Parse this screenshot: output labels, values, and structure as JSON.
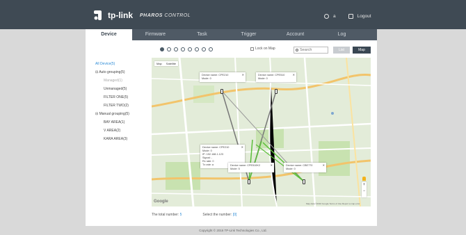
{
  "header": {
    "brand": "tp-link",
    "product_prefix": "PHAROS",
    "product_suffix": "CONTROL",
    "user_initial": "a",
    "logout_label": "Logout"
  },
  "nav": {
    "tabs": [
      {
        "label": "Device",
        "active": true
      },
      {
        "label": "Firmware",
        "active": false
      },
      {
        "label": "Task",
        "active": false
      },
      {
        "label": "Trigger",
        "active": false
      },
      {
        "label": "Account",
        "active": false
      },
      {
        "label": "Log",
        "active": false
      }
    ]
  },
  "sidebar": {
    "items": [
      {
        "label": "All Device(5)"
      },
      {
        "label": "Auto grouping(5)"
      },
      {
        "label": "Managed(1)"
      },
      {
        "label": "Unmanaged(5)"
      },
      {
        "label": "FILTER ONE(5)"
      },
      {
        "label": "FILTER TWO(2)"
      },
      {
        "label": "Manual grouping(5)"
      },
      {
        "label": "BAY AREA(1)"
      },
      {
        "label": "V AREA(2)"
      },
      {
        "label": "KARA AREA(3)"
      }
    ]
  },
  "toolbar": {
    "lock_label": "Lock on Map",
    "search_placeholder": "Search",
    "list_label": "List",
    "map_label": "Map"
  },
  "map": {
    "type_map": "Map",
    "type_satellite": "Satellite",
    "google": "Google",
    "attribution": "Map data ©2016 Google   Terms of Use   Report a map error",
    "popups": [
      {
        "name": "Device name:  CPE210",
        "mode": "Mode:  0"
      },
      {
        "name": "Device name:  CPE510",
        "mode": "Mode:  0"
      },
      {
        "name": "Device name:  CPE210",
        "mode": "Mode:  0",
        "ip": "IP:  192.168.1.123",
        "signal": "Signal:  -",
        "rx": "Rx rate:  0",
        "tx": "Tx rate:  a"
      },
      {
        "name": "Device name:  CPE510K2",
        "mode": "Mode:  5"
      },
      {
        "name": "Device name:  CBE770",
        "mode": "Mode:  0"
      }
    ]
  },
  "footer": {
    "total_label": "The total number:",
    "total_value": "5",
    "select_label": "Select the number:",
    "select_value": "[0]",
    "copyright": "Copyright © 2016 TP-Link Technologies Co., Ltd."
  }
}
